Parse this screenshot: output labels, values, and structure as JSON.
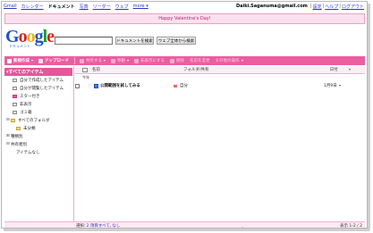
{
  "topnav": {
    "items": [
      {
        "label": "Gmail",
        "active": false
      },
      {
        "label": "カレンダー",
        "active": false
      },
      {
        "label": "ドキュメント",
        "active": true
      },
      {
        "label": "写真",
        "active": false
      },
      {
        "label": "リーダー",
        "active": false
      },
      {
        "label": "ウェブ",
        "active": false
      },
      {
        "label": "more ▾",
        "active": false
      }
    ],
    "email": "Daiki.Saganuma@gmail.com",
    "links": [
      "設定",
      "ヘルプ",
      "ログアウト"
    ]
  },
  "banner": {
    "text": "Happy Valentine's Day!"
  },
  "logo": {
    "text": "Google",
    "subtitle": "ドキュメント"
  },
  "search": {
    "value": "",
    "doc_button": "ドキュメントを検索",
    "web_button": "ウェブ全体から検索"
  },
  "toolbar": {
    "new_label": "新規作成",
    "upload_label": "アップロード",
    "share_label": "共有する",
    "move_label": "移動",
    "hide_label": "非表示にする",
    "delete_label": "削除",
    "rename_label": "名前を変更",
    "more_label": "その他の操作"
  },
  "sidebar": {
    "all_items": "すべてのアイテム",
    "items": [
      {
        "label": "自分で作成したアイテム"
      },
      {
        "label": "自分が閲覧したアイテム"
      },
      {
        "label": "スター付き"
      },
      {
        "label": "非表示"
      },
      {
        "label": "ゴミ箱"
      }
    ],
    "folders_label": "すべてのフォルダ",
    "unsaved_label": "未分類",
    "types_label": "種類別",
    "shared_label": "共有者別",
    "no_items": "アイテムなし"
  },
  "table": {
    "headers": {
      "name": "名前",
      "folder": "フォルダ/共有",
      "date": "日付"
    },
    "group_label": "今年",
    "rows": [
      {
        "title": "公開範囲を試してみる",
        "folder_tag": "自分",
        "date": "1月9日"
      }
    ]
  },
  "footer": {
    "select_label": "選択:",
    "select_all": "2 項目すべて",
    "select_none": "なし",
    "pages": "表示 1-2 / 2"
  },
  "colors": {
    "accent_pink": "#ea5ea0",
    "banner_bg": "#fbe1ee",
    "link_blue": "#2a37c9"
  }
}
